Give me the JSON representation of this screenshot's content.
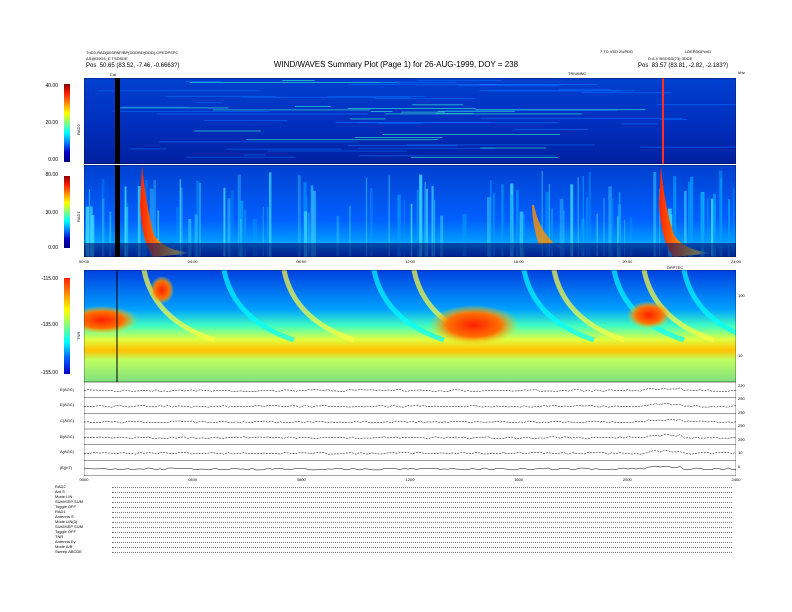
{
  "header": {
    "left_line1": "TnD3-RAD(00SPAP/BP(DDDBD)DDD)-OFEDPSPC",
    "left_line2": "AS@D9D3_E TSDSDE",
    "left_pos_label": "Pos",
    "left_pos_value": "50.65 (83.52, -7.46, -0.6663?)",
    "title": "WIND/WAVES Summary Plot (Page 1) for 26-AUG-1999, DOY = 238",
    "right_line1": "7.TD VED ZUPDD",
    "right_line2": "LDEPDDPcnD",
    "right_line3": "D.A.V BSDSD(73) 3DDE",
    "right_pos_label": "Pos",
    "right_pos_value": "83.57 (83.81, -2.82, -2.183?)",
    "right_sub_a": "TRIUMNC",
    "right_sub_b": "kHz",
    "marker_label": "Cal",
    "midmark": "DPPTEC"
  },
  "panels": {
    "rad2": {
      "name": "RAD2",
      "ticks": [
        "40.00",
        "20.00",
        "0.00"
      ]
    },
    "rad1": {
      "name": "RAD1",
      "ticks": [
        "80.00",
        "30.00",
        "0.00"
      ]
    },
    "tnr": {
      "name": "TNR",
      "ticks": [
        "-115.00",
        "-135.00",
        "-155.00"
      ],
      "right_ticks": [
        "100",
        "10"
      ]
    },
    "lines": {
      "labels": [
        "E(AGC)",
        "E(AGC)",
        "C(AGC)",
        "B(AGC)",
        "A(AGC)",
        "|B|(nT)"
      ],
      "right_ticks": [
        "220",
        "250",
        "250",
        "250",
        "250",
        "10",
        "0"
      ]
    }
  },
  "chart_data": [
    {
      "type": "heatmap",
      "panel": "RAD2",
      "ylim": [
        0,
        40
      ],
      "yticks": [
        0,
        20,
        40
      ],
      "xlim": [
        0,
        24
      ],
      "xlabel": "",
      "ylabel": "RAD2"
    },
    {
      "type": "heatmap",
      "panel": "RAD1",
      "ylim": [
        0,
        80
      ],
      "yticks": [
        0,
        30,
        80
      ],
      "xlim": [
        0,
        24
      ],
      "xlabel": "",
      "ylabel": "RAD1",
      "xticks": [
        "00:00",
        "04:00",
        "08:00",
        "12:00",
        "16:00",
        "20:00",
        "24:00"
      ]
    },
    {
      "type": "heatmap",
      "panel": "TNR",
      "ylim": [
        -155,
        -115
      ],
      "yticks": [
        -155,
        -135,
        -115
      ],
      "xlim": [
        0,
        24
      ],
      "ylabel": "TNR",
      "right_axis_ticks": [
        10,
        100
      ],
      "xticks": [
        "00:00",
        "04:00",
        "08:00",
        "12:00",
        "16:00",
        "20:00",
        "24:00"
      ]
    },
    {
      "type": "line",
      "panel": "lines",
      "xlim": [
        0,
        24
      ],
      "series_labels": [
        "E(AGC)",
        "E(AGC)",
        "C(AGC)",
        "B(AGC)",
        "A(AGC)",
        "|B|(nT)"
      ],
      "xticks": [
        "0000",
        "0400",
        "0800",
        "1200",
        "1600",
        "2000",
        "2400"
      ]
    }
  ],
  "footer": {
    "rows": [
      "RAD2",
      "Ant   S",
      "Mode  LIN",
      "SUM/SEP  SUM",
      "Toggle  OFF",
      "RAD1",
      "Antenna  S",
      "Mode  LIN(3)",
      "SUM/SEP SUM",
      "Toggle  OFF",
      "TNR",
      "Antenna  Ey",
      "Mode  A/B",
      "Sweep  ABCDE"
    ]
  },
  "colors": {
    "background": "#0000a0",
    "burst": "#ff2000"
  }
}
